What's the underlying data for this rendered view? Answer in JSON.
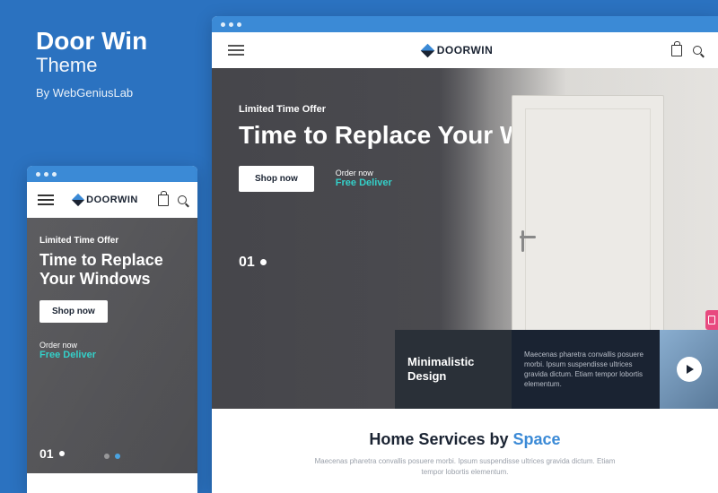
{
  "info": {
    "title": "Door Win",
    "subtitle": "Theme",
    "author": "By WebGeniusLab"
  },
  "brand": "DOORWIN",
  "hero": {
    "offer": "Limited Time Offer",
    "headline": "Time to Replace Your Windows",
    "cta": "Shop now",
    "order_label": "Order now",
    "deliver": "Free Deliver",
    "counter": "01"
  },
  "feature": {
    "title": "Minimalistic Design",
    "text": "Maecenas pharetra convallis posuere morbi. Ipsum suspendisse ultrices gravida dictum. Etiam tempor lobortis elementum."
  },
  "services": {
    "title_a": "Home Services by ",
    "title_b": "Space",
    "sub": "Maecenas pharetra convallis posuere morbi. Ipsum suspendisse ultrices gravida dictum. Etiam tempor lobortis elementum."
  }
}
